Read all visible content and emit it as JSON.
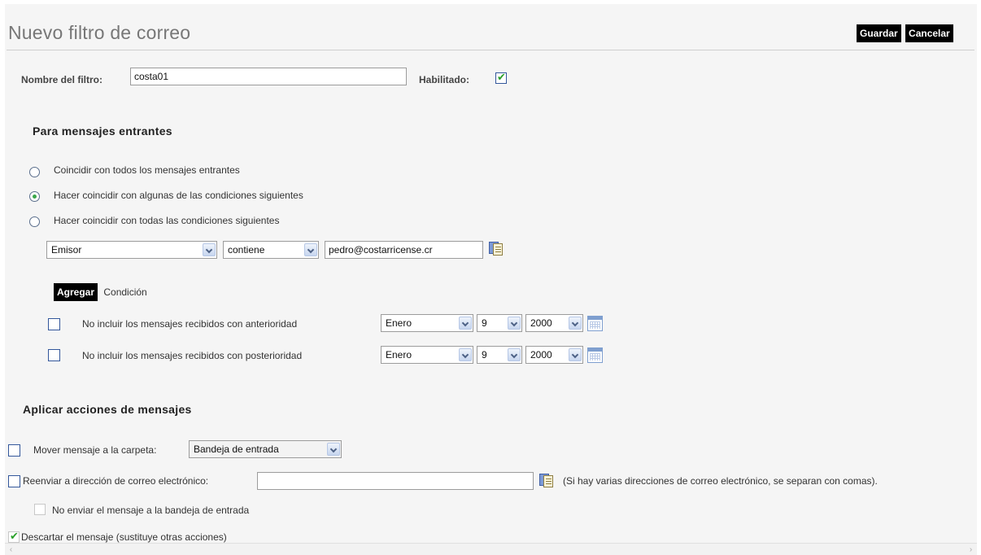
{
  "header": {
    "title": "Nuevo filtro de correo",
    "save_label": "Guardar",
    "cancel_label": "Cancelar"
  },
  "filter": {
    "name_label": "Nombre del filtro:",
    "name_value": "costa01",
    "enabled_label": "Habilitado:",
    "enabled_checked": true
  },
  "incoming": {
    "section_title": "Para mensajes entrantes",
    "match_options": [
      {
        "label": "Coincidir con todos los mensajes entrantes",
        "selected": false
      },
      {
        "label": "Hacer coincidir con algunas de las condiciones siguientes",
        "selected": true
      },
      {
        "label": "Hacer coincidir con todas las condiciones siguientes",
        "selected": false
      }
    ],
    "condition": {
      "field": "Emisor",
      "operator": "contiene",
      "value": "pedro@costarricense.cr"
    },
    "add_button_label": "Agregar",
    "add_button_suffix": "Condición",
    "date_rules": [
      {
        "label": "No incluir los mensajes recibidos con anterioridad",
        "checked": false,
        "month": "Enero",
        "day": "9",
        "year": "2000"
      },
      {
        "label": "No incluir los mensajes recibidos con posterioridad",
        "checked": false,
        "month": "Enero",
        "day": "9",
        "year": "2000"
      }
    ]
  },
  "actions": {
    "section_title": "Aplicar acciones de mensajes",
    "move_label": "Mover mensaje a la carpeta:",
    "move_checked": false,
    "move_folder": "Bandeja de entrada",
    "forward_label": "Reenviar a dirección de correo electrónico:",
    "forward_checked": false,
    "forward_value": "",
    "forward_hint": "(Si hay varias direcciones de correo electrónico, se separan con comas).",
    "no_inbox_label": "No enviar el mensaje a la bandeja de entrada",
    "no_inbox_checked": false,
    "discard_label": "Descartar el mensaje (sustituye otras acciones)",
    "discard_checked": true
  },
  "icons": {
    "checkmark": "✔",
    "address_book": "address-book-icon",
    "calendar": "calendar-icon"
  },
  "colors": {
    "button_bg": "#000000",
    "check_green": "#2aa02a",
    "page_bg": "#f5f5f5"
  }
}
